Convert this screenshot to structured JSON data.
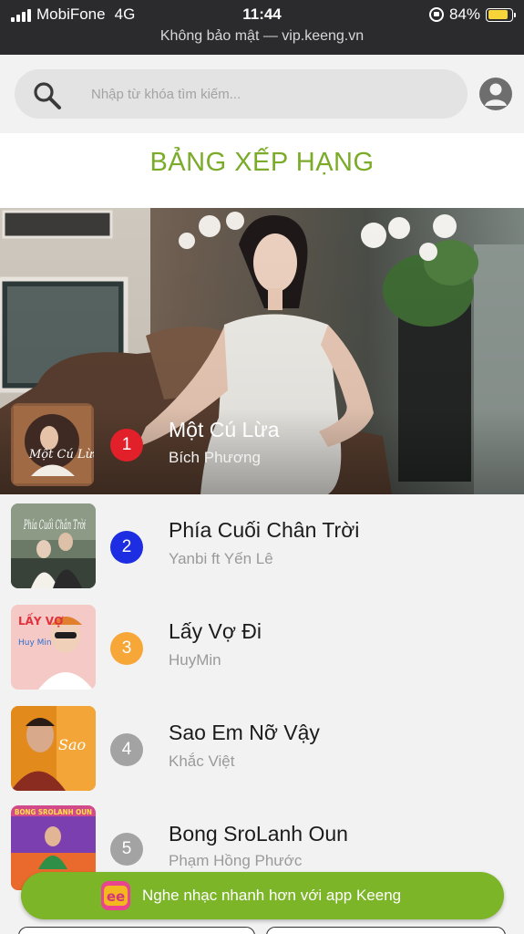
{
  "status_bar": {
    "carrier": "MobiFone",
    "network": "4G",
    "time": "11:44",
    "battery_percent": "84%",
    "battery_level": 0.84,
    "url_text": "Không bảo mật — vip.keeng.vn"
  },
  "search": {
    "placeholder": "Nhập từ khóa tìm kiếm..."
  },
  "page_title": "BẢNG XẾP HẠNG",
  "rank_colors": {
    "1": "#e1202a",
    "2": "#1d2de2",
    "3": "#f7a638",
    "other": "#a3a3a3"
  },
  "songs": [
    {
      "rank": "1",
      "title": "Một Cú Lừa",
      "artist": "Bích Phương"
    },
    {
      "rank": "2",
      "title": "Phía Cuối Chân Trời",
      "artist": "Yanbi ft Yến Lê"
    },
    {
      "rank": "3",
      "title": "Lấy Vợ Đi",
      "artist": "HuyMin"
    },
    {
      "rank": "4",
      "title": "Sao Em Nỡ Vậy",
      "artist": "Khắc Việt"
    },
    {
      "rank": "5",
      "title": "Bong SroLanh Oun",
      "artist": "Phạm Hồng Phước"
    }
  ],
  "thumbnails": {
    "t1": "Một Cú Lừa",
    "t2": "Phía Cuối Chân Trời",
    "t3": "LẤY VỢ",
    "t3b": "Huy Min",
    "t4": "Sao",
    "t5": "BONG SROLANH OUN"
  },
  "banner": {
    "text": "Nghe nhạc nhanh hơn với app Keeng",
    "logo_text": "ee"
  },
  "accent_color": "#7aab29"
}
